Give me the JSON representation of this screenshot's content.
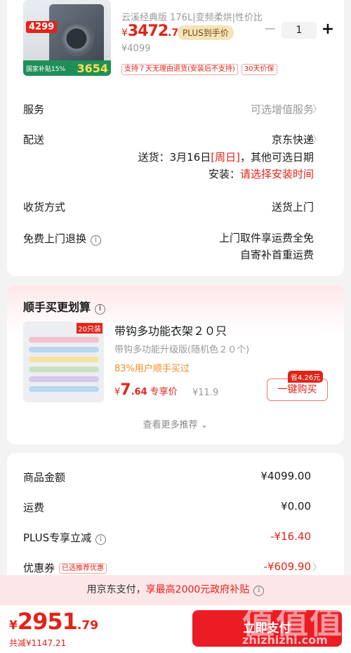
{
  "product": {
    "spec": "云溪经典版 176L|变频柔烘|性价比",
    "price_symbol": "¥",
    "price_int": "3472",
    "price_dec": ".7",
    "plus_tag": "PLUS到手价",
    "orig_price": "¥4099",
    "quantity": "1",
    "minus": "−",
    "plus": "+",
    "tags": [
      "支持７天无理由退货(安装后不支持)",
      "30天价保"
    ],
    "thumb_price": "4299",
    "thumb_subsidy": "3654",
    "thumb_subsidy_label": "国家补贴15%"
  },
  "service": {
    "label": "服务",
    "value": "可选增值服务"
  },
  "delivery": {
    "label": "配送",
    "carrier": "京东快递",
    "line1_prefix": "送货：3月16日",
    "line1_day": "[周日]",
    "line1_suffix": "，其他可选日期",
    "line2_prefix": "安装：",
    "line2_action": "请选择安装时间"
  },
  "receive": {
    "label": "收货方式",
    "value": "送货上门"
  },
  "return": {
    "label": "免费上门退换",
    "line1": "上门取件享运费全免",
    "line2": "自寄补首重运费",
    "info": "i"
  },
  "recommend": {
    "title": "顺手买更划算",
    "info": "i",
    "count_tag": "20只装",
    "name": "带钩多功能衣架２０只",
    "desc": "带钩多功能升级版(随机色２０个)",
    "rate": "83%用户顺手买过",
    "price_symbol": "¥",
    "price_int": "7",
    "price_dec": ".64",
    "price_label": "专享价",
    "orig": "¥11.9",
    "save": "省4.26元",
    "buy": "一键购买",
    "more": "查看更多推荐 ⌄"
  },
  "summary": {
    "rows": [
      {
        "label": "商品金额",
        "value": "¥4099.00"
      },
      {
        "label": "运费",
        "value": "¥0.00"
      },
      {
        "label": "PLUS专享立减",
        "value": "-¥16.40"
      },
      {
        "label": "优惠券",
        "value": "-¥609.90",
        "tag": "已选推荐优惠"
      }
    ],
    "info": "i"
  },
  "pay_banner": {
    "prefix": "用京东支付，",
    "highlight": "享最高2000元政府补贴",
    "info": "i"
  },
  "bottom": {
    "symbol": "¥",
    "total_int": "2951",
    "total_dec": ".79",
    "saved": "共减¥1147.21",
    "submit": "立即支付"
  },
  "watermark": {
    "big": "值值值",
    "url": "zhizhizhi.com"
  },
  "colors": {
    "accent": "#e2231a",
    "banner": "#fde6e8",
    "plus_gold": "#f6e3b9"
  }
}
